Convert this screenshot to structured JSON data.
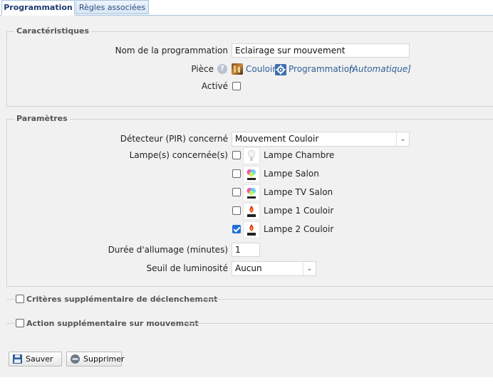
{
  "tabs": [
    {
      "label": "Programmation",
      "active": true
    },
    {
      "label": "Règles associées",
      "active": false
    }
  ],
  "characteristics": {
    "legend": "Caractéristiques",
    "name_label": "Nom de la programmation",
    "name_value": "Eclairage sur mouvement",
    "room_label": "Pièce",
    "room_link": "Couloir",
    "program_link": "Programmation",
    "program_mode": "[Automatique]",
    "active_label": "Activé",
    "active_checked": false
  },
  "parameters": {
    "legend": "Paramètres",
    "detector_label": "Détecteur (PIR) concerné",
    "detector_value": "Mouvement Couloir",
    "lamps_label": "Lampe(s) concernée(s)",
    "lamps": [
      {
        "name": "Lampe Chambre",
        "checked": false,
        "icon": "white-bulb-icon"
      },
      {
        "name": "Lampe Salon",
        "checked": false,
        "icon": "color-bulb-icon"
      },
      {
        "name": "Lampe TV Salon",
        "checked": false,
        "icon": "color-bulb-icon"
      },
      {
        "name": "Lampe 1 Couloir",
        "checked": false,
        "icon": "flame-bulb-icon"
      },
      {
        "name": "Lampe 2 Couloir",
        "checked": true,
        "icon": "flame-bulb-icon"
      }
    ],
    "duration_label": "Durée d'allumage (minutes)",
    "duration_value": "1",
    "threshold_label": "Seuil de luminosité",
    "threshold_value": "Aucun"
  },
  "extra_criteria": {
    "label": "Critères supplémentaire de déclenchement",
    "checked": false
  },
  "extra_action": {
    "label": "Action supplémentaire sur mouvement",
    "checked": false
  },
  "buttons": {
    "save": "Sauver",
    "delete": "Supprimer"
  },
  "colors": {
    "accent": "#2f5f97",
    "checkbox_checked": "#1f6fd6",
    "panel_bg": "#f1f1f1"
  }
}
